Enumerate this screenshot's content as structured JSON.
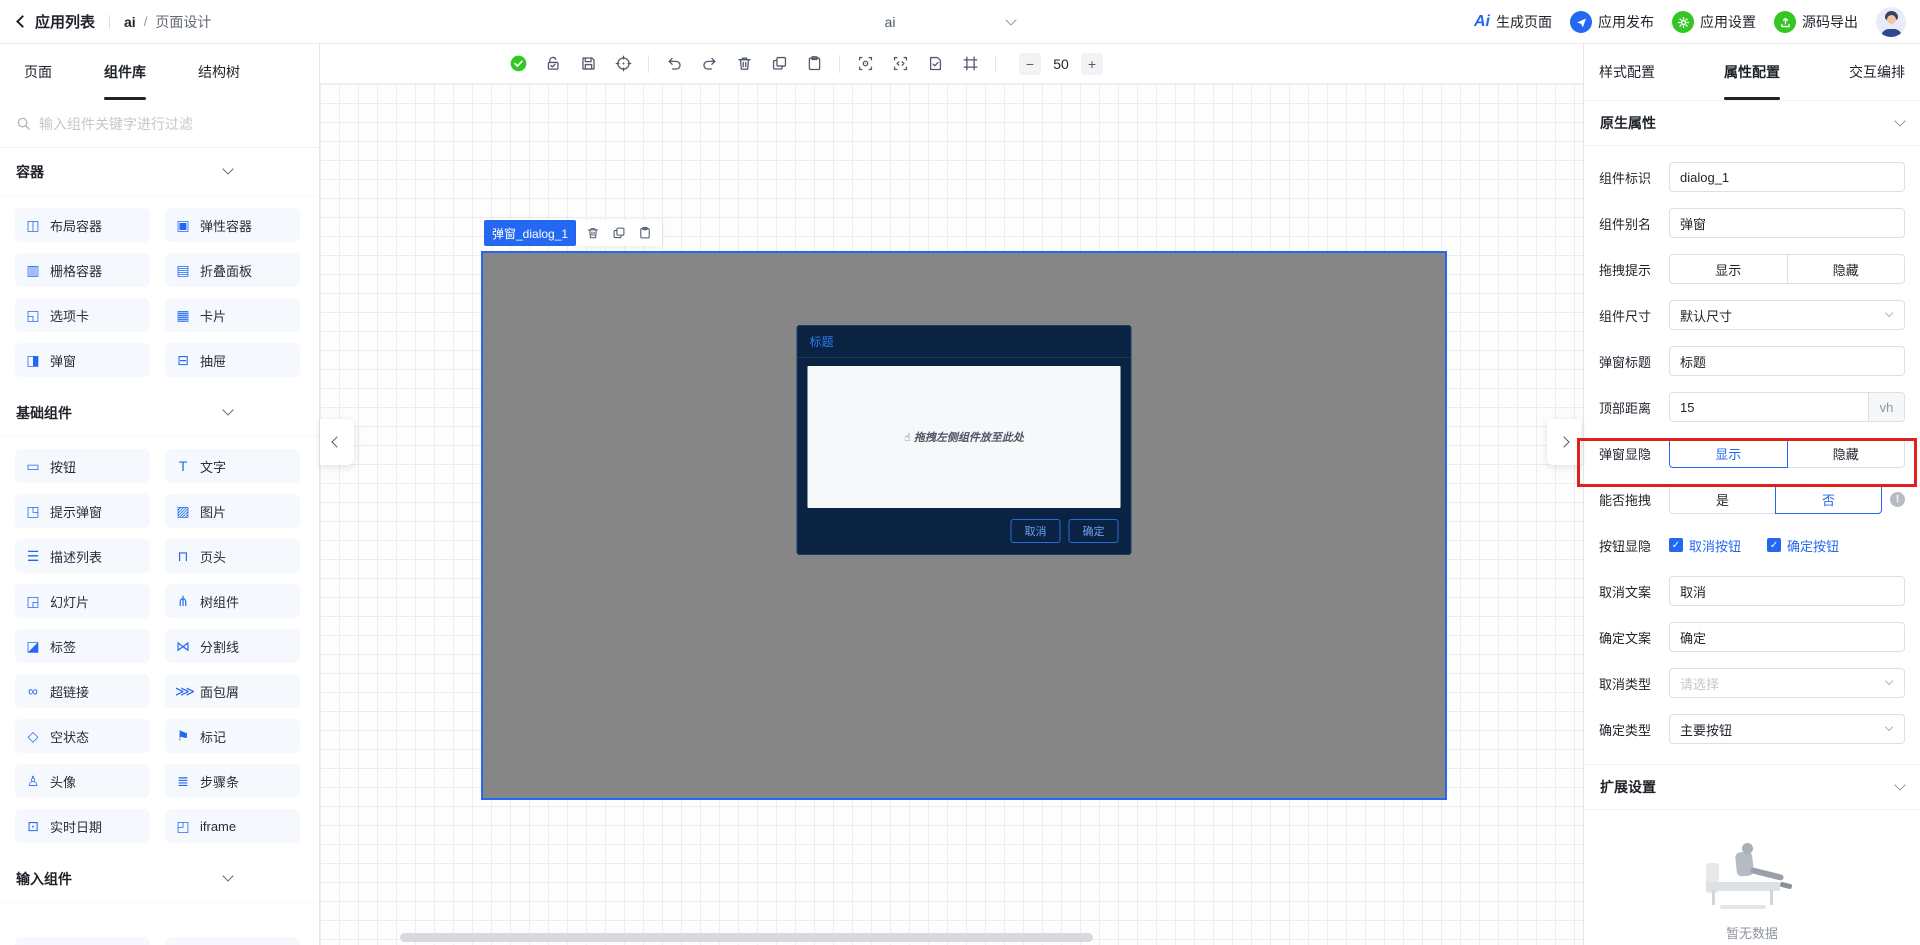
{
  "colors": {
    "accent": "#2468f2",
    "green": "#34c724",
    "annotation_red": "#e01f1f",
    "dialog_bg": "#0a2342",
    "artboard_gray": "#868686"
  },
  "header": {
    "back_label": "应用列表",
    "app_name": "ai",
    "separator": "/",
    "page_name": "页面设计",
    "app_select_value": "ai",
    "actions": [
      {
        "icon_text": "Ai",
        "label": "生成页面"
      },
      {
        "label": "应用发布"
      },
      {
        "label": "应用设置"
      },
      {
        "label": "源码导出"
      }
    ]
  },
  "left_panel": {
    "tabs": [
      {
        "label": "页面"
      },
      {
        "label": "组件库",
        "active": true
      },
      {
        "label": "结构树"
      }
    ],
    "search_placeholder": "输入组件关键字进行过滤",
    "sections": [
      {
        "title": "容器",
        "items": [
          {
            "icon": "◫",
            "label": "布局容器"
          },
          {
            "icon": "▣",
            "label": "弹性容器"
          },
          {
            "icon": "▥",
            "label": "栅格容器"
          },
          {
            "icon": "▤",
            "label": "折叠面板"
          },
          {
            "icon": "◱",
            "label": "选项卡"
          },
          {
            "icon": "▦",
            "label": "卡片"
          },
          {
            "icon": "◨",
            "label": "弹窗"
          },
          {
            "icon": "⊟",
            "label": "抽屉"
          }
        ]
      },
      {
        "title": "基础组件",
        "items": [
          {
            "icon": "▭",
            "label": "按钮"
          },
          {
            "icon": "T",
            "label": "文字"
          },
          {
            "icon": "◳",
            "label": "提示弹窗"
          },
          {
            "icon": "▨",
            "label": "图片"
          },
          {
            "icon": "☰",
            "label": "描述列表"
          },
          {
            "icon": "⊓",
            "label": "页头"
          },
          {
            "icon": "◲",
            "label": "幻灯片"
          },
          {
            "icon": "⋔",
            "label": "树组件"
          },
          {
            "icon": "◪",
            "label": "标签"
          },
          {
            "icon": "⋈",
            "label": "分割线"
          },
          {
            "icon": "∞",
            "label": "超链接"
          },
          {
            "icon": "⋙",
            "label": "面包屑"
          },
          {
            "icon": "◇",
            "label": "空状态"
          },
          {
            "icon": "⚑",
            "label": "标记"
          },
          {
            "icon": "♙",
            "label": "头像"
          },
          {
            "icon": "≣",
            "label": "步骤条"
          },
          {
            "icon": "⊡",
            "label": "实时日期"
          },
          {
            "icon": "◰",
            "label": "iframe"
          }
        ]
      },
      {
        "title": "输入组件",
        "items": []
      }
    ]
  },
  "toolbar": {
    "zoom": "50",
    "icon_names": [
      "status-ok-icon",
      "unlock-icon",
      "save-icon",
      "target-icon",
      "undo-icon",
      "redo-icon",
      "trash-icon",
      "copy-icon",
      "paste-icon",
      "preview-icon",
      "code-icon",
      "page-check-icon",
      "frame-icon",
      "zoom-out-icon",
      "zoom-in-icon"
    ]
  },
  "canvas": {
    "selected_badge": "弹窗_dialog_1",
    "badge_icon_names": [
      "trash-icon",
      "copy-icon",
      "paste-icon"
    ],
    "dialog": {
      "title": "标题",
      "drop_hint": "拖拽左侧组件放至此处",
      "cancel_label": "取消",
      "confirm_label": "确定"
    }
  },
  "right_panel": {
    "tabs": [
      {
        "label": "样式配置"
      },
      {
        "label": "属性配置",
        "active": true
      },
      {
        "label": "交互编排"
      }
    ],
    "section_native": "原生属性",
    "section_extended": "扩展设置",
    "fields": [
      {
        "label": "组件标识",
        "value": "dialog_1"
      },
      {
        "label": "组件别名",
        "value": "弹窗"
      },
      {
        "label": "拖拽提示",
        "options": [
          "显示",
          "隐藏"
        ],
        "selected": ""
      },
      {
        "label": "组件尺寸",
        "value": "默认尺寸"
      },
      {
        "label": "弹窗标题",
        "value": "标题"
      },
      {
        "label": "顶部距离",
        "value": "15",
        "suffix": "vh"
      },
      {
        "label": "弹窗显隐",
        "options": [
          "显示",
          "隐藏"
        ],
        "selected": "显示",
        "annotated": true
      },
      {
        "label": "能否拖拽",
        "options": [
          "是",
          "否"
        ],
        "selected": "否"
      },
      {
        "label": "按钮显隐",
        "options": [
          "取消按钮",
          "确定按钮"
        ],
        "checked": [
          true,
          true
        ]
      },
      {
        "label": "取消文案",
        "value": "取消"
      },
      {
        "label": "确定文案",
        "value": "确定"
      },
      {
        "label": "取消类型",
        "placeholder": "请选择"
      },
      {
        "label": "确定类型",
        "value": "主要按钮"
      }
    ],
    "empty_text": "暂无数据"
  }
}
